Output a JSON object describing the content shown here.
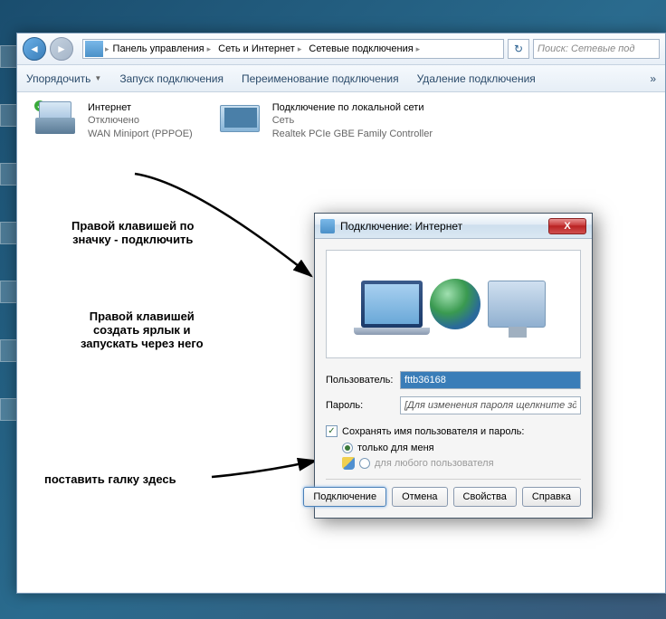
{
  "breadcrumb": {
    "seg1": "Панель управления",
    "seg2": "Сеть и Интернет",
    "seg3": "Сетевые подключения"
  },
  "search": {
    "placeholder": "Поиск: Сетевые под"
  },
  "toolbar": {
    "organize": "Упорядочить",
    "start": "Запуск подключения",
    "rename": "Переименование подключения",
    "delete": "Удаление подключения",
    "more": "»"
  },
  "conn1": {
    "title": "Интернет",
    "status": "Отключено",
    "device": "WAN Miniport (PPPOE)"
  },
  "conn2": {
    "title": "Подключение по локальной сети",
    "status": "Сеть",
    "device": "Realtek PCIe GBE Family Controller"
  },
  "annotations": {
    "a1": "Правой клавишей по\nзначку - подключить",
    "a2": "Правой клавишей\nсоздать ярлык и\nзапускать через него",
    "a3": "поставить галку здесь"
  },
  "dialog": {
    "title": "Подключение: Интернет",
    "userLabel": "Пользователь:",
    "userValue": "fttb36168",
    "passLabel": "Пароль:",
    "passValue": "[Для изменения пароля щелкните здесь]",
    "saveCheck": "Сохранять имя пользователя и пароль:",
    "radioMe": "только для меня",
    "radioAll": "для любого пользователя",
    "btnConnect": "Подключение",
    "btnCancel": "Отмена",
    "btnProps": "Свойства",
    "btnHelp": "Справка"
  }
}
